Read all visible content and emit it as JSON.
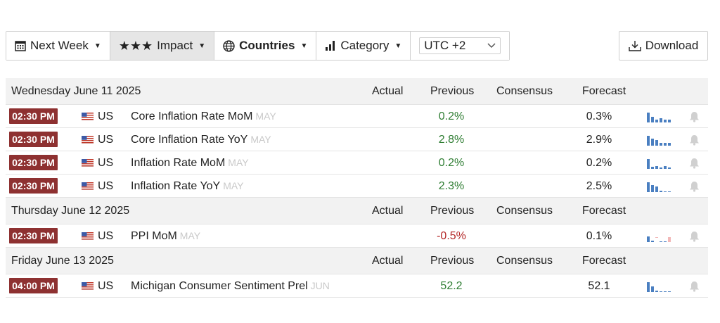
{
  "toolbar": {
    "week_label": "Next Week",
    "impact_label": "Impact",
    "countries_label": "Countries",
    "category_label": "Category",
    "timezone_value": "UTC +2",
    "download_label": "Download"
  },
  "columns": {
    "actual": "Actual",
    "previous": "Previous",
    "consensus": "Consensus",
    "forecast": "Forecast"
  },
  "days": [
    {
      "label": "Wednesday June 11 2025",
      "events": [
        {
          "time": "02:30 PM",
          "country": "US",
          "name": "Core Inflation Rate MoM",
          "period": "MAY",
          "actual": "",
          "previous": "0.2%",
          "consensus": "",
          "forecast": "0.3%"
        },
        {
          "time": "02:30 PM",
          "country": "US",
          "name": "Core Inflation Rate YoY",
          "period": "MAY",
          "actual": "",
          "previous": "2.8%",
          "consensus": "",
          "forecast": "2.9%"
        },
        {
          "time": "02:30 PM",
          "country": "US",
          "name": "Inflation Rate MoM",
          "period": "MAY",
          "actual": "",
          "previous": "0.2%",
          "consensus": "",
          "forecast": "0.2%"
        },
        {
          "time": "02:30 PM",
          "country": "US",
          "name": "Inflation Rate YoY",
          "period": "MAY",
          "actual": "",
          "previous": "2.3%",
          "consensus": "",
          "forecast": "2.5%"
        }
      ]
    },
    {
      "label": "Thursday June 12 2025",
      "events": [
        {
          "time": "02:30 PM",
          "country": "US",
          "name": "PPI MoM",
          "period": "MAY",
          "actual": "",
          "previous": "-0.5%",
          "consensus": "",
          "forecast": "0.1%"
        }
      ]
    },
    {
      "label": "Friday June 13 2025",
      "events": [
        {
          "time": "04:00 PM",
          "country": "US",
          "name": "Michigan Consumer Sentiment Prel",
          "period": "JUN",
          "actual": "",
          "previous": "52.2",
          "consensus": "",
          "forecast": "52.1"
        }
      ]
    }
  ],
  "colors": {
    "time_badge": "#8e3131",
    "positive": "#2e7d32",
    "negative": "#b32424",
    "minichart_bar": "#4a7fc1",
    "minichart_negative": "#f2b8b8"
  }
}
